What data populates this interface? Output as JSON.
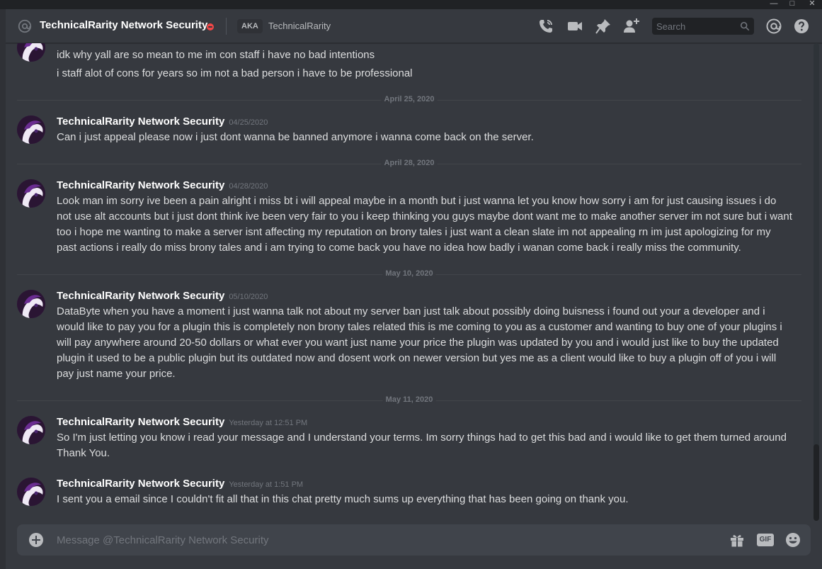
{
  "header": {
    "title": "TechnicalRarity Network Security",
    "aka_label": "AKA",
    "aka_name": "TechnicalRarity",
    "search_placeholder": "Search"
  },
  "messages": [
    {
      "type": "continuation",
      "lines": [
        "idk why yall are so mean to me im con staff i have no bad intentions",
        "i staff alot of cons for years so im not a bad person i have to be professional"
      ]
    },
    {
      "type": "separator",
      "date": "April 25, 2020"
    },
    {
      "type": "message",
      "author": "TechnicalRarity Network Security",
      "timestamp": "04/25/2020",
      "text": "Can i just appeal please now i just dont wanna be banned anymore i wanna come back on the server."
    },
    {
      "type": "separator",
      "date": "April 28, 2020"
    },
    {
      "type": "message",
      "author": "TechnicalRarity Network Security",
      "timestamp": "04/28/2020",
      "text": "Look man im sorry ive been a pain alright i miss bt i will appeal maybe in a month but i just wanna let you know how sorry i am for just causing issues i do not use alt accounts but i just dont think ive been very fair to you i keep thinking you guys maybe dont want me to make another server im not sure but i want too i hope me wanting to make a server isnt affecting my reputation on brony tales i just want a clean slate im not appealing rn im just apologizing for my past actions i really do miss brony tales and i am trying to come back you have no idea how badly i wanan come back i really miss the community."
    },
    {
      "type": "separator",
      "date": "May 10, 2020"
    },
    {
      "type": "message",
      "author": "TechnicalRarity Network Security",
      "timestamp": "05/10/2020",
      "text": "DataByte when you have a moment i just wanna talk not about my server ban just talk about possibly doing buisness i found out your a developer and i would like to pay you for a plugin this is completely non brony tales related this is me coming to you as a customer and wanting to buy one of your plugins i will pay anywhere around 20-50 dollars or what ever you want just name your price the plugin was updated by you and i would just like to buy the updated plugin it used to be a public plugin but its outdated now and dosent work on newer version but yes me as a client would like to buy a plugin off of you i will pay just name your price."
    },
    {
      "type": "separator",
      "date": "May 11, 2020"
    },
    {
      "type": "message",
      "author": "TechnicalRarity Network Security",
      "timestamp": "Yesterday at 12:51 PM",
      "text": "So I'm just letting you know i read your message and I understand your terms. Im sorry things had to get this bad and i would like to get them turned around Thank You."
    },
    {
      "type": "message",
      "author": "TechnicalRarity Network Security",
      "timestamp": "Yesterday at 1:51 PM",
      "text": "I sent you a email since I couldn't fit all that in this chat pretty much sums up everything that has been going on thank you."
    }
  ],
  "composer": {
    "placeholder": "Message @TechnicalRarity Network Security",
    "gif_label": "GIF"
  },
  "colors": {
    "background": "#36393f",
    "header_text": "#ffffff",
    "message_text": "#dcddde",
    "timestamp": "#72767d",
    "dnd_status": "#f04747"
  }
}
